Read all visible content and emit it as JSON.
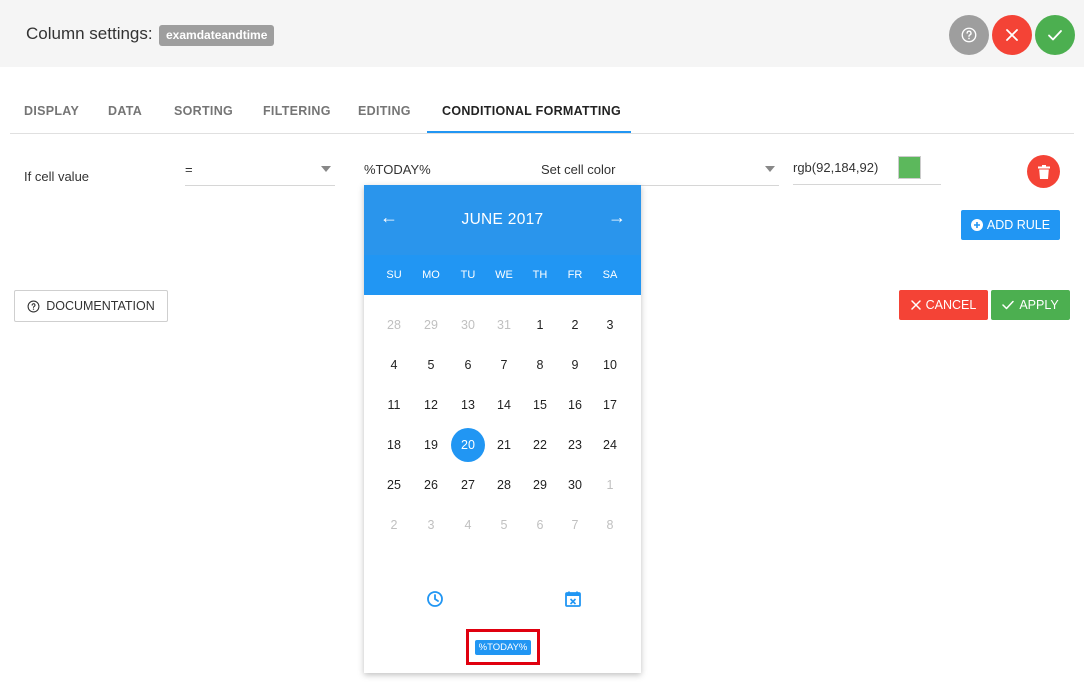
{
  "header": {
    "title": "Column settings:",
    "column_name": "examdateandtime"
  },
  "tabs": [
    {
      "label": "DISPLAY",
      "active": false
    },
    {
      "label": "DATA",
      "active": false
    },
    {
      "label": "SORTING",
      "active": false
    },
    {
      "label": "FILTERING",
      "active": false
    },
    {
      "label": "EDITING",
      "active": false
    },
    {
      "label": "CONDITIONAL FORMATTING",
      "active": true
    }
  ],
  "rule": {
    "label": "If cell value",
    "operator": "=",
    "value": "%TODAY%",
    "action": "Set cell color",
    "color_text": "rgb(92,184,92)",
    "color_swatch": "#5cb85c"
  },
  "buttons": {
    "add_rule": "ADD RULE",
    "documentation": "DOCUMENTATION",
    "cancel": "CANCEL",
    "apply": "APPLY"
  },
  "picker": {
    "month_label": "JUNE 2017",
    "prev_arrow": "←",
    "next_arrow": "→",
    "weekdays": [
      "SU",
      "MO",
      "TU",
      "WE",
      "TH",
      "FR",
      "SA"
    ],
    "weeks": [
      [
        "28",
        "29",
        "30",
        "31",
        "1",
        "2",
        "3"
      ],
      [
        "4",
        "5",
        "6",
        "7",
        "8",
        "9",
        "10"
      ],
      [
        "11",
        "12",
        "13",
        "14",
        "15",
        "16",
        "17"
      ],
      [
        "18",
        "19",
        "20",
        "21",
        "22",
        "23",
        "24"
      ],
      [
        "25",
        "26",
        "27",
        "28",
        "29",
        "30",
        "1"
      ],
      [
        "2",
        "3",
        "4",
        "5",
        "6",
        "7",
        "8"
      ]
    ],
    "selected_day": "20",
    "today_button": "%TODAY%"
  },
  "colors": {
    "accent": "#2196f3",
    "danger": "#f44336",
    "success": "#4caf50",
    "neutral": "#9e9e9e"
  }
}
